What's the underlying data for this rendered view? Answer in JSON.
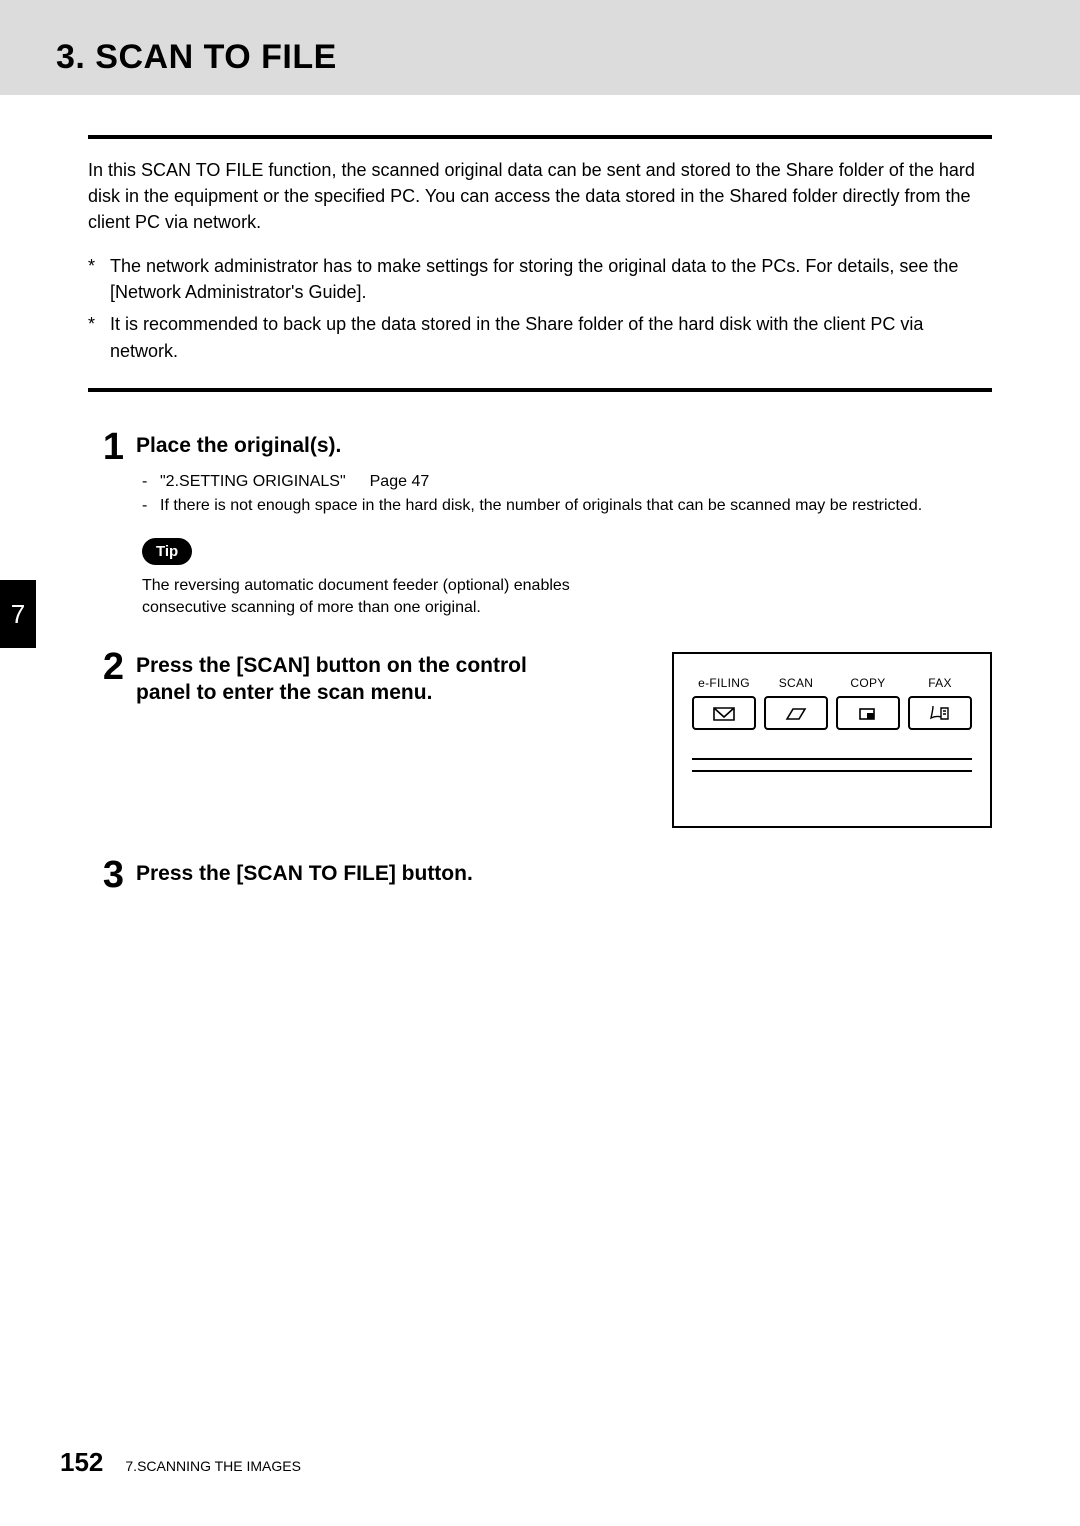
{
  "header": {
    "title": "3. SCAN TO FILE"
  },
  "intro": "In this SCAN TO FILE function, the scanned original data can be sent and stored to the Share folder of the hard disk in the equipment or the specified PC. You can access the data stored in the Shared folder directly from the client PC via network.",
  "notes": [
    "The network administrator has to make settings for storing the original data to the PCs. For details, see the [Network Administrator's Guide].",
    "It is recommended to back up the data stored in the Share folder of the hard disk with the client PC via network."
  ],
  "steps": {
    "s1": {
      "num": "1",
      "title": "Place the original(s).",
      "ref_label": "\"2.SETTING ORIGINALS\"",
      "ref_page": "Page 47",
      "sub2": "If there is not enough space in the hard disk, the number of originals that can be scanned may be restricted.",
      "tip_label": "Tip",
      "tip_text": "The reversing automatic document feeder (optional) enables consecutive scanning of more than one original."
    },
    "s2": {
      "num": "2",
      "title": "Press the [SCAN] button on the control panel to enter the scan menu."
    },
    "s3": {
      "num": "3",
      "title": "Press the [SCAN TO FILE] button."
    }
  },
  "panel": {
    "efiling": "e-FILING",
    "scan": "SCAN",
    "copy": "COPY",
    "fax": "FAX"
  },
  "side_tab": "7",
  "footer": {
    "page": "152",
    "chapter": "7.SCANNING THE IMAGES"
  }
}
